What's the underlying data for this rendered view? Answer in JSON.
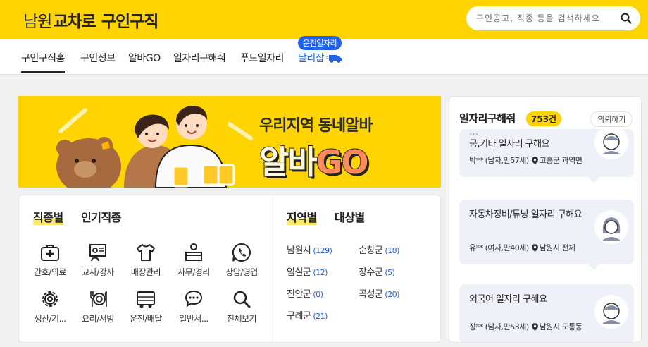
{
  "header": {
    "logo_city": "남원",
    "logo_brand": "교차로",
    "logo_sub": "구인구직",
    "search_placeholder": "구인공고, 직종 등을 검색하세요"
  },
  "nav": {
    "items": [
      {
        "label": "구인구직홈"
      },
      {
        "label": "구인정보"
      },
      {
        "label": "알바GO"
      },
      {
        "label": "일자리구해줘"
      },
      {
        "label": "푸드일자리"
      },
      {
        "label": "달리잡"
      }
    ],
    "badge": "운전일자리"
  },
  "banner": {
    "tagline": "우리지역 동네알바",
    "title_part1": "알바",
    "title_part2": "GO"
  },
  "categories": {
    "tabs": [
      "직종별",
      "인기직종"
    ],
    "items": [
      {
        "label": "간호/의료",
        "icon": "medical-kit-icon"
      },
      {
        "label": "교사/강사",
        "icon": "teacher-board-icon"
      },
      {
        "label": "매장관리",
        "icon": "shirt-icon"
      },
      {
        "label": "사무/경리",
        "icon": "office-desk-icon"
      },
      {
        "label": "상담/영업",
        "icon": "phone-chat-icon"
      },
      {
        "label": "생산/기...",
        "icon": "gear-icon"
      },
      {
        "label": "요리/서빙",
        "icon": "dining-icon"
      },
      {
        "label": "운전/배달",
        "icon": "bus-icon"
      },
      {
        "label": "일반서...",
        "icon": "speech-bubble-icon"
      },
      {
        "label": "전체보기",
        "icon": "search-icon"
      }
    ]
  },
  "regions": {
    "tabs": [
      "지역별",
      "대상별"
    ],
    "items": [
      {
        "name": "남원시",
        "count": "(129)"
      },
      {
        "name": "순창군",
        "count": "(18)"
      },
      {
        "name": "임실군",
        "count": "(12)"
      },
      {
        "name": "장수군",
        "count": "(5)"
      },
      {
        "name": "진안군",
        "count": "(0)"
      },
      {
        "name": "곡성군",
        "count": "(20)"
      },
      {
        "name": "구례군",
        "count": "(21)"
      }
    ]
  },
  "job_requests": {
    "title": "일자리구해줘",
    "count": "753건",
    "button": "의뢰하기",
    "items": [
      {
        "title": "공,기타 일자리 구해요",
        "person": "박** (남자,만57세)",
        "location": "고흥군 과역면"
      },
      {
        "title": "자동차정비/튜닝 일자리 구해요",
        "person": "유** (여자,만40세)",
        "location": "남원시 전체"
      },
      {
        "title": "외국어 일자리 구해요",
        "person": "장** (남자,만53세)",
        "location": "남원시 도통동"
      }
    ]
  }
}
